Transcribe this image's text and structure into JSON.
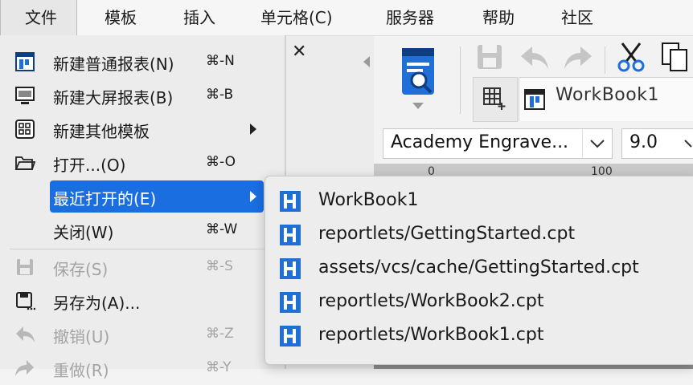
{
  "menubar": {
    "items": [
      {
        "label": "文件"
      },
      {
        "label": "模板"
      },
      {
        "label": "插入"
      },
      {
        "label": "单元格(C)"
      },
      {
        "label": "服务器"
      },
      {
        "label": "帮助"
      },
      {
        "label": "社区"
      }
    ]
  },
  "file_menu": {
    "items": [
      {
        "label": "新建普通报表(N)",
        "shortcut": "⌘-N",
        "icon": "new-report-icon"
      },
      {
        "label": "新建大屏报表(B)",
        "shortcut": "⌘-B",
        "icon": "monitor-icon"
      },
      {
        "label": "新建其他模板",
        "shortcut": "",
        "icon": "template-grid-icon"
      },
      {
        "label": "打开...(O)",
        "shortcut": "⌘-O",
        "icon": "folder-open-icon"
      },
      {
        "label": "最近打开的(E)",
        "shortcut": "",
        "icon": ""
      },
      {
        "label": "关闭(W)",
        "shortcut": "⌘-W",
        "icon": ""
      },
      {
        "label": "保存(S)",
        "shortcut": "⌘-S",
        "icon": "save-icon"
      },
      {
        "label": "另存为(A)...",
        "shortcut": "",
        "icon": "save-as-icon"
      },
      {
        "label": "撤销(U)",
        "shortcut": "⌘-Z",
        "icon": "undo-icon"
      },
      {
        "label": "重做(R)",
        "shortcut": "⌘-Y",
        "icon": "redo-icon"
      }
    ]
  },
  "recent_submenu": {
    "items": [
      {
        "label": "WorkBook1"
      },
      {
        "label": "reportlets/GettingStarted.cpt"
      },
      {
        "label": "assets/vcs/cache/GettingStarted.cpt"
      },
      {
        "label": "reportlets/WorkBook2.cpt"
      },
      {
        "label": "reportlets/WorkBook1.cpt"
      }
    ]
  },
  "toolbar": {
    "workbook_tab": "WorkBook1",
    "font_name": "Academy Engrave...",
    "font_size": "9.0",
    "ruler_marks": [
      "0",
      "100"
    ]
  },
  "colors": {
    "accent": "#1a6ee0",
    "icon_blue": "#1f6fd6",
    "icon_dark": "#0d3f80"
  }
}
